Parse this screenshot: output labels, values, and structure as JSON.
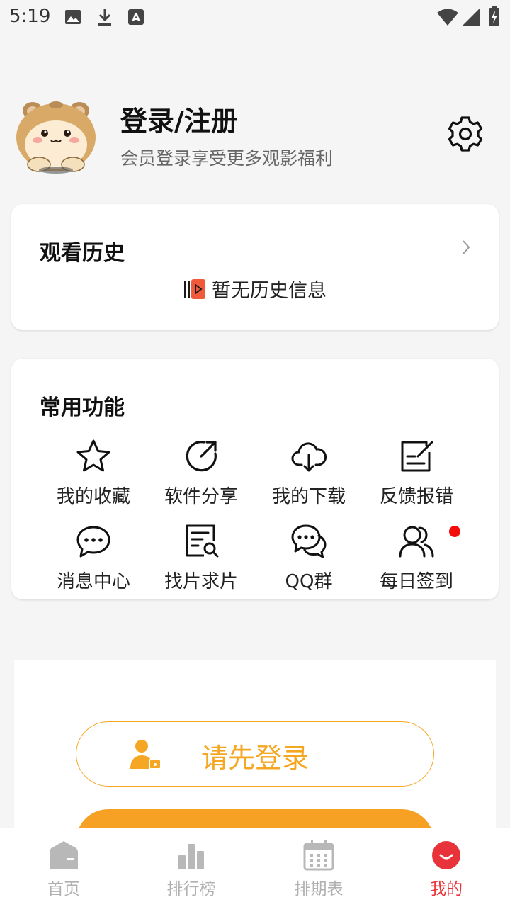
{
  "status_bar": {
    "time": "5:19",
    "icons": [
      "image-icon",
      "download-icon",
      "a-font-icon",
      "wifi-icon",
      "signal-icon",
      "battery-icon"
    ]
  },
  "profile": {
    "title": "登录/注册",
    "subtitle": "会员登录享受更多观影福利"
  },
  "history": {
    "title": "观看历史",
    "empty_text": "暂无历史信息"
  },
  "functions": {
    "title": "常用功能",
    "items": [
      {
        "label": "我的收藏",
        "icon": "star-icon"
      },
      {
        "label": "软件分享",
        "icon": "share-icon"
      },
      {
        "label": "我的下载",
        "icon": "cloud-download-icon"
      },
      {
        "label": "反馈报错",
        "icon": "feedback-icon"
      },
      {
        "label": "消息中心",
        "icon": "message-icon"
      },
      {
        "label": "找片求片",
        "icon": "search-doc-icon"
      },
      {
        "label": "QQ群",
        "icon": "chat-bubbles-icon"
      },
      {
        "label": "每日签到",
        "icon": "users-icon",
        "badge": true
      }
    ]
  },
  "login_panel": {
    "button_label": "请先登录"
  },
  "nav": {
    "items": [
      {
        "label": "首页",
        "icon": "home-icon",
        "active": false
      },
      {
        "label": "排行榜",
        "icon": "bar-chart-icon",
        "active": false
      },
      {
        "label": "排期表",
        "icon": "calendar-icon",
        "active": false
      },
      {
        "label": "我的",
        "icon": "smile-icon",
        "active": true
      }
    ]
  },
  "colors": {
    "accent_orange": "#f5a623",
    "active_red": "#e8333b",
    "badge_red": "#f40b0b"
  }
}
